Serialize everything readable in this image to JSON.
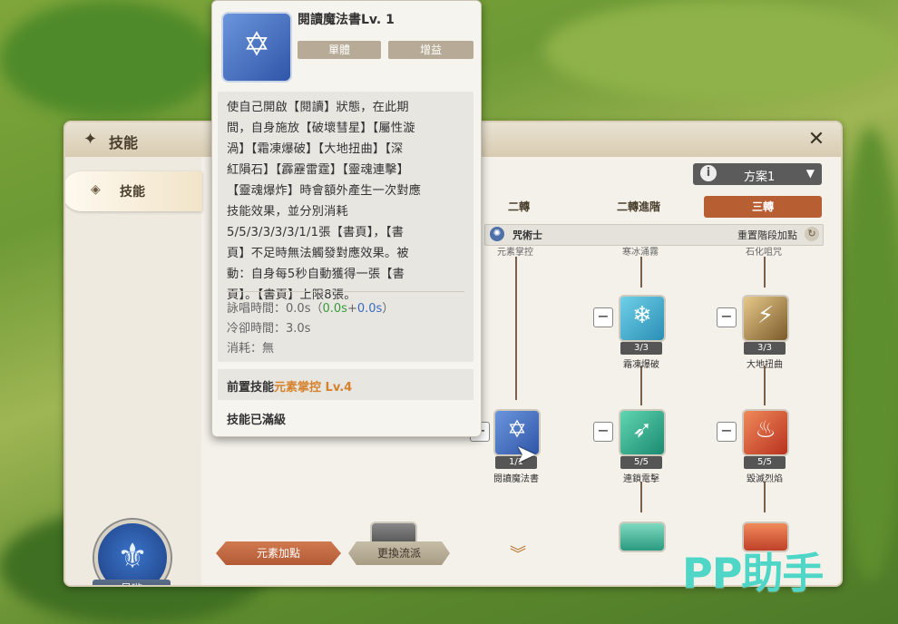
{
  "panel": {
    "title": "技能",
    "side_tab": "技能",
    "class_name": "星璇"
  },
  "plan": {
    "label": "方案1"
  },
  "tabs": {
    "job2": "二轉",
    "job2_adv": "二轉進階",
    "job3": "三轉"
  },
  "class_bar": {
    "label": "咒術士",
    "reset": "重置階段加點"
  },
  "faded_labels": [
    "元素掌控",
    "寒冰涌霧",
    "石化咀咒"
  ],
  "skills": {
    "frost_burst": {
      "name": "霜凍爆破",
      "level": "3/3"
    },
    "earth_twist": {
      "name": "大地扭曲",
      "level": "3/3"
    },
    "read_book": {
      "name": "閱讀魔法書",
      "level": "1/1"
    },
    "chain_thunder": {
      "name": "連鎖電擊",
      "level": "5/5"
    },
    "ruin_flame": {
      "name": "毀滅烈焰",
      "level": "5/5"
    }
  },
  "buttons": {
    "element": "元素加點",
    "switch": "更換流派"
  },
  "tooltip": {
    "title": "閱讀魔法書Lv. 1",
    "tag1": "單體",
    "tag2": "增益",
    "desc": "使自己開啟【閱讀】狀態，在此期\n間，自身施放【破壞彗星】【屬性漩\n渦】【霜凍爆破】【大地扭曲】【深\n紅隕石】【霹靂雷霆】【靈魂連擊】\n【靈魂爆炸】時會額外產生一次對應\n技能效果，並分別消耗\n5/5/3/3/3/3/1/1張【書頁】，【書\n頁】不足時無法觸發對應效果。被\n動：自身每5秒自動獲得一張【書\n頁】。【書頁】上限8張。",
    "cast_label": "詠唱時間：",
    "cast_value": "0.0s",
    "cast_open": "（",
    "cast_green": "0.0s",
    "cast_plus": "+",
    "cast_blue": "0.0s",
    "cast_close": "）",
    "cooldown": "冷卻時間：3.0s",
    "cost": "消耗：無",
    "prereq_label": "前置技能",
    "prereq_skill": "元素掌控 Lv.4",
    "maxed": "技能已滿級"
  },
  "watermark": "PP助手",
  "colors": {
    "accent": "#b85e33",
    "prereq": "#d6822c",
    "watermark": "#4fd6c6"
  }
}
